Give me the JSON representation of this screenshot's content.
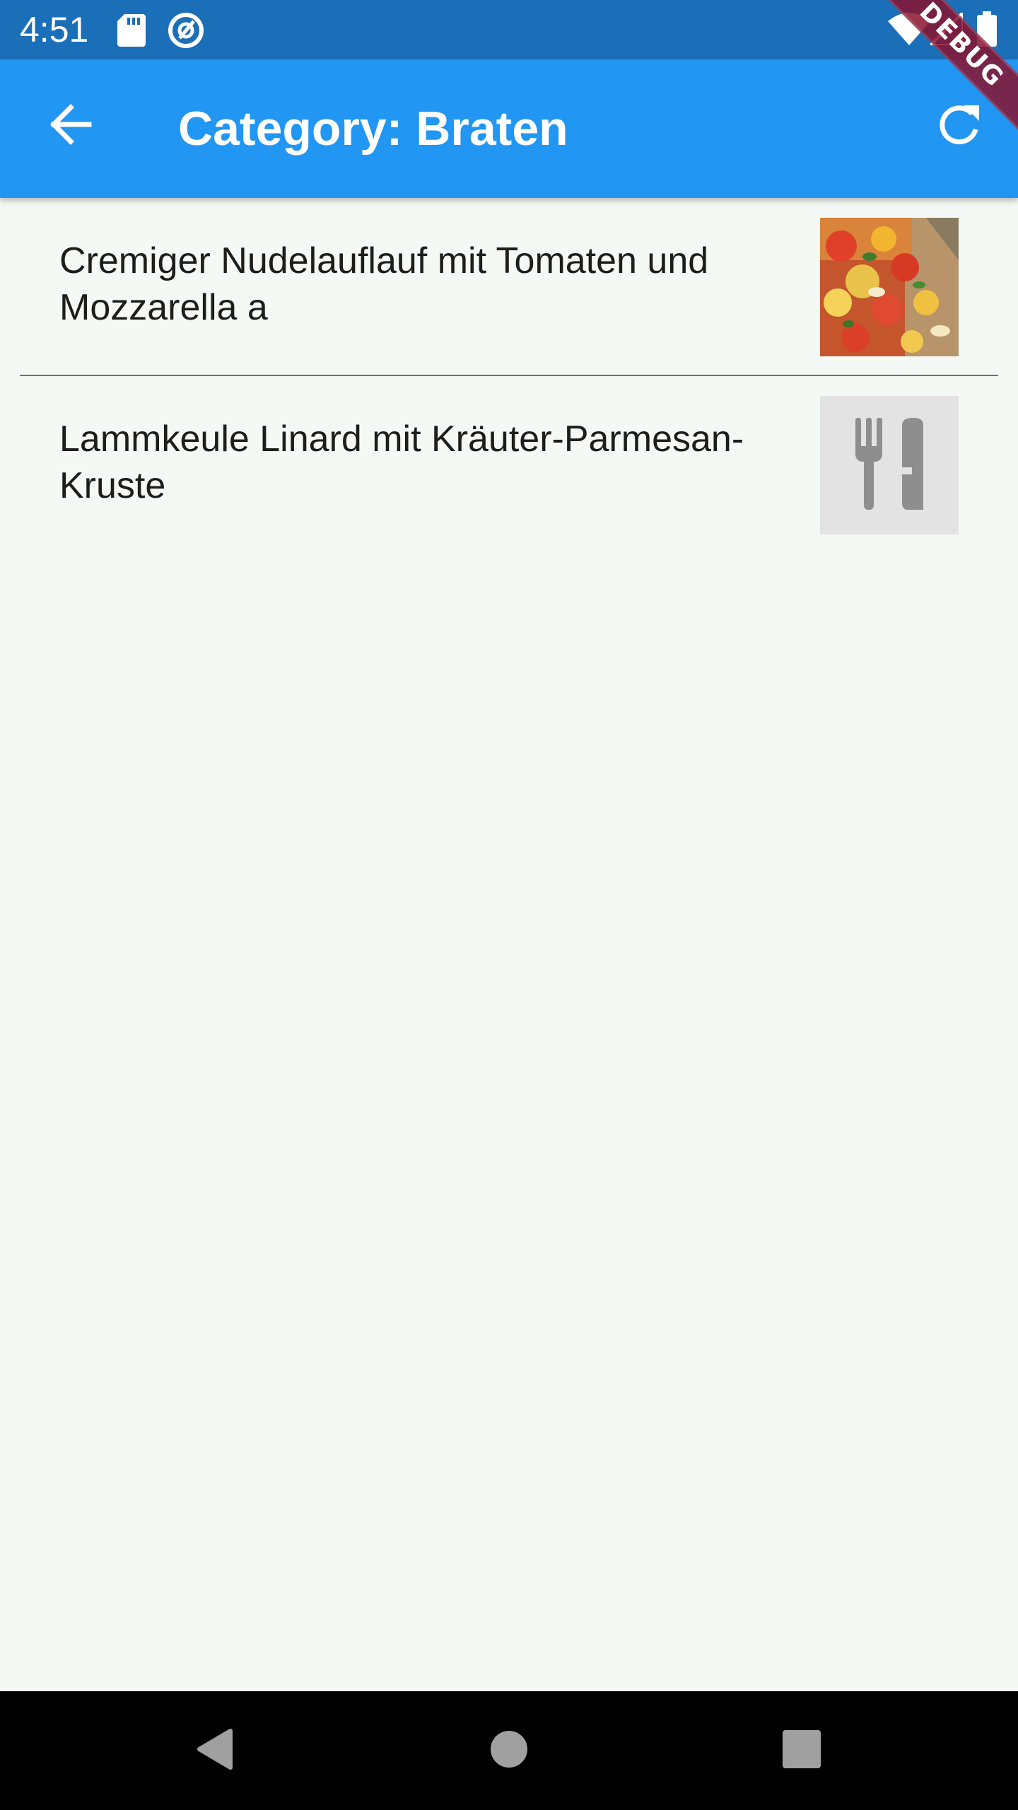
{
  "status_bar": {
    "time": "4:51",
    "icons": [
      "sd-card-icon",
      "at-sign-icon",
      "wifi-icon",
      "signal-icon",
      "battery-icon"
    ]
  },
  "app_bar": {
    "title": "Category: Braten",
    "back_icon": "arrow-back-icon",
    "refresh_icon": "refresh-icon",
    "color": "#2196f3"
  },
  "debug_banner": "DEBUG",
  "recipes": [
    {
      "title": "Cremiger Nudelauflauf mit Tomaten und Mozzarella a",
      "thumbnail": "pasta-bake-photo"
    },
    {
      "title": "Lammkeule Linard mit Kräuter-Parmesan-Kruste",
      "thumbnail": "restaurant-icon"
    }
  ],
  "nav_bar": {
    "buttons": [
      "back-triangle-icon",
      "home-circle-icon",
      "recents-square-icon"
    ]
  }
}
